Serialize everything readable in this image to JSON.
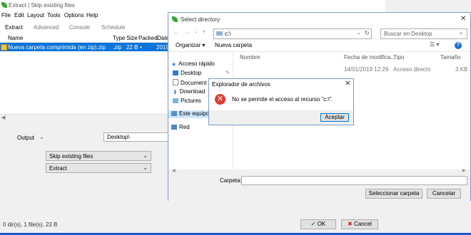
{
  "main_window": {
    "title": "Extract | Skip existing files",
    "menu": [
      "File",
      "Edit",
      "Layout",
      "Tools",
      "Options",
      "Help"
    ],
    "tabs": [
      "Extract",
      "Advanced",
      "Console",
      "Schedule"
    ],
    "columns": [
      "Name",
      "Type",
      "Size",
      "Packed",
      "Date/"
    ],
    "row": {
      "name": "Nueva carpeta comprimida (en zip).zip",
      "type": ".zip",
      "size": "22 B",
      "packed": "•",
      "date": "2019-"
    },
    "output_label": "Output",
    "output_value": "Desktop\\",
    "mode1": "Skip existing files",
    "mode2": "Extract",
    "status": "0 dir(s), 1 file(s), 22 B",
    "ok_label": "OK",
    "cancel_label": "Cancel"
  },
  "select_dialog": {
    "title": "Select directory",
    "address": "c:\\",
    "search_placeholder": "Buscar en Desktop",
    "organize": "Organizar",
    "new_folder": "Nueva carpeta",
    "nav": [
      "Acceso rápido",
      "Desktop",
      "Document",
      "Download",
      "Pictures",
      "Este equipo",
      "Red"
    ],
    "columns": [
      "Nombre",
      "Fecha de modifica...",
      "Tipo",
      "Tamaño"
    ],
    "row": {
      "date": "14/01/2019 12:29",
      "type": "Acceso directo",
      "size": "3 KB"
    },
    "folder_label": "Carpeta:",
    "select_button": "Seleccionar carpeta",
    "cancel_button": "Cancelar"
  },
  "error_dialog": {
    "title": "Explorador de archivos",
    "message": "No se permite el acceso al recurso \"c:\\\".",
    "accept": "Aceptar"
  },
  "colors": {
    "selection": "#0a74d8",
    "error": "#e03a2e",
    "accent": "#0078d7"
  }
}
